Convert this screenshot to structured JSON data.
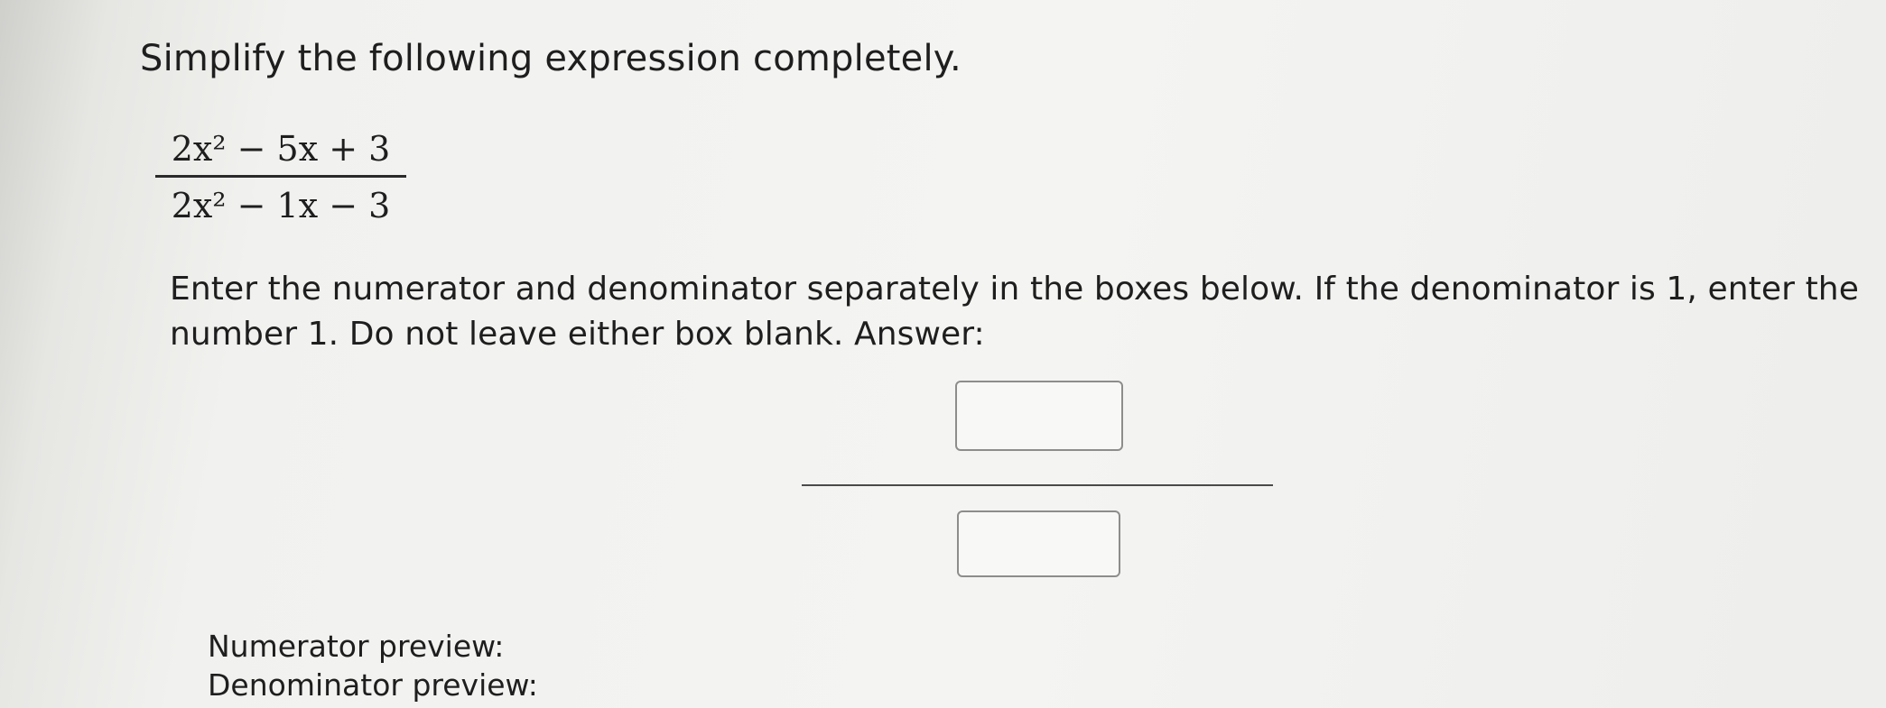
{
  "problem": {
    "prompt": "Simplify the following expression completely.",
    "expression": {
      "numerator": "2x² − 5x + 3",
      "denominator": "2x² − 1x − 3"
    },
    "instructions_line1": "Enter the numerator and denominator separately in the boxes below. If the denominator is 1, enter the",
    "instructions_line2": "number 1. Do not leave either box blank. Answer:"
  },
  "answer": {
    "numerator_value": "",
    "denominator_value": ""
  },
  "preview": {
    "numerator_label": "Numerator preview:",
    "denominator_label": "Denominator preview:"
  }
}
